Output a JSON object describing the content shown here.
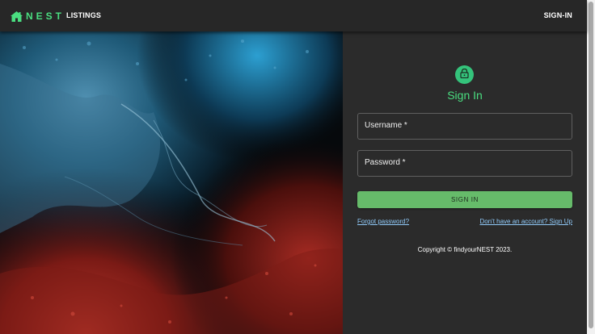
{
  "header": {
    "logo_text": "NEST",
    "logo_icon": "house-icon",
    "nav_listings": "LISTINGS",
    "nav_signin": "SIGN-IN"
  },
  "colors": {
    "brand_green": "#4ade80",
    "button_green": "#66bb6a",
    "link_blue": "#90caf9",
    "background": "#2b2b2b",
    "appbar": "#272727"
  },
  "signin": {
    "avatar_icon": "lock-icon",
    "title": "Sign In",
    "username_label": "Username *",
    "password_label": "Password *",
    "submit_label": "SIGN IN",
    "forgot_link": "Forgot password?",
    "signup_link": "Don't have an account? Sign Up",
    "copyright": "Copyright © findyourNEST 2023."
  },
  "hero": {
    "image_description_icon": "abstract-fluid-art-image"
  }
}
